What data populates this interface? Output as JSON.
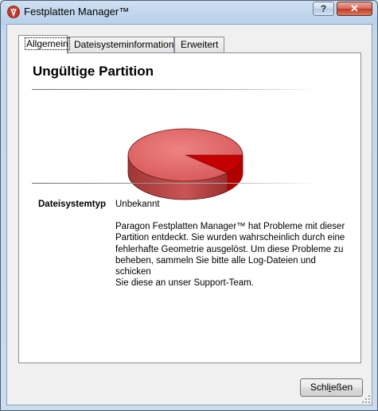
{
  "window": {
    "title": "Festplatten Manager™",
    "help_label": "?",
    "close_label": "✕"
  },
  "tabs": [
    {
      "label": "Allgemein",
      "active": true
    },
    {
      "label": "Dateisysteminformation",
      "active": false
    },
    {
      "label": "Erweitert",
      "active": false
    }
  ],
  "panel": {
    "title": "Ungültige Partition",
    "pie": {
      "used_fraction": 0.12,
      "used_color": "#c40000",
      "free_color": "#e06262"
    },
    "property_label": "Dateisystemtyp",
    "property_value": "Unbekannt",
    "description_lines": [
      "Paragon Festplatten Manager™ hat Probleme mit dieser",
      "Partition entdeckt. Sie wurden wahrscheinlich durch eine",
      "fehlerhafte Geometrie ausgelöst. Um diese Probleme zu",
      "beheben, sammeln Sie bitte alle Log-Dateien und schicken",
      "Sie diese an unser Support-Team."
    ]
  },
  "footer": {
    "close_button_prefix": "Schl",
    "close_button_mnemonic": "i",
    "close_button_suffix": "eßen"
  }
}
